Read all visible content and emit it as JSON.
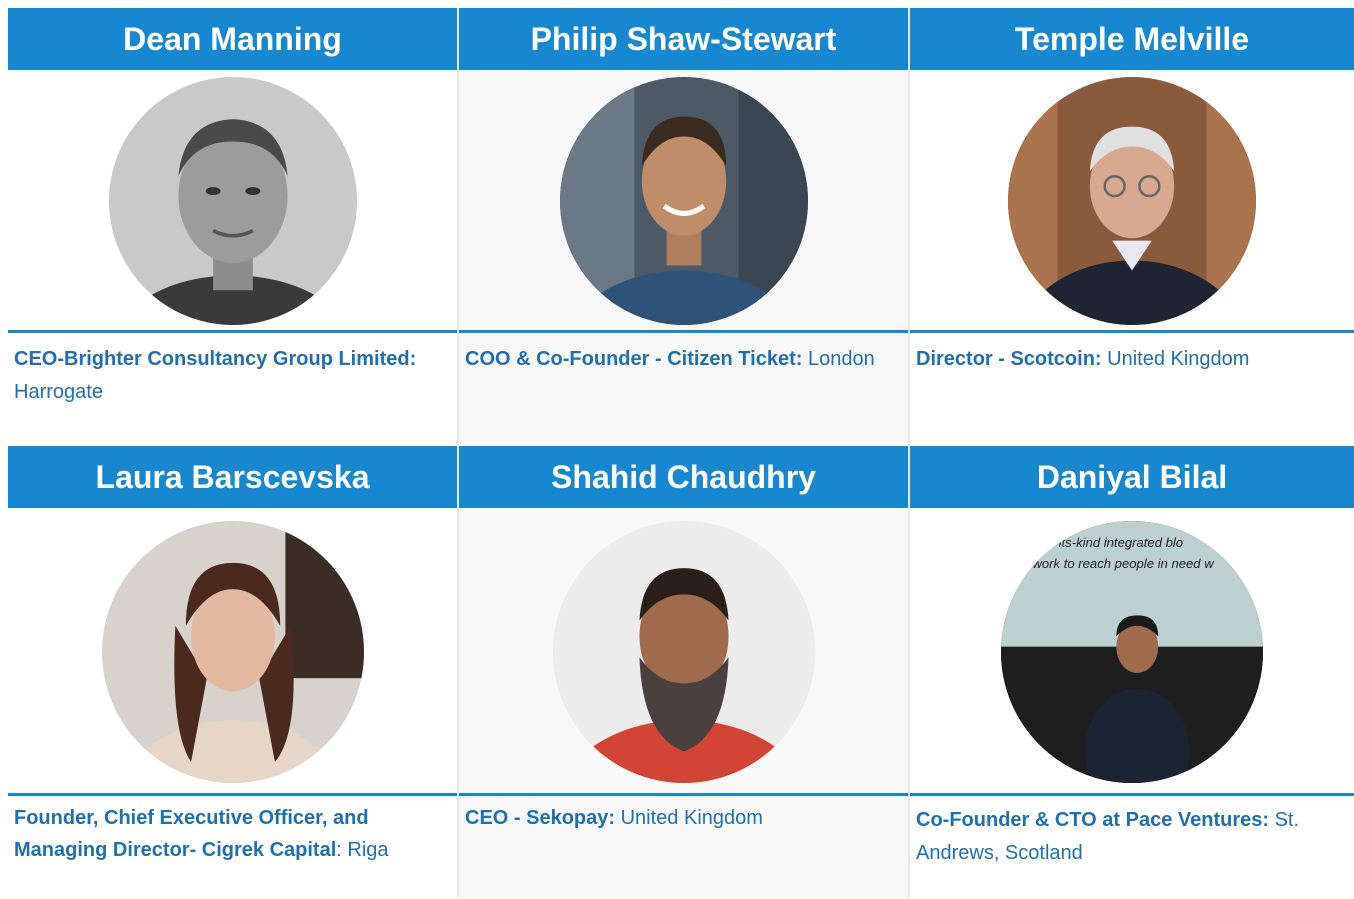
{
  "row1": [
    {
      "name": "Dean Manning",
      "role": "CEO-Brighter Consultancy Group Limited:",
      "location": " Harrogate",
      "photo": "dean-manning-photo"
    },
    {
      "name": "Philip Shaw-Stewart",
      "role": "COO & Co-Founder - Citizen Ticket:",
      "location": " London",
      "photo": "philip-shaw-stewart-photo"
    },
    {
      "name": "Temple Melville",
      "role": "Director - Scotcoin:",
      "location": " United Kingdom",
      "photo": "temple-melville-photo"
    }
  ],
  "row2": [
    {
      "name": "Laura Barscevska",
      "role": "Founder, Chief Executive Officer, and Managing Director- Cigrek Capital",
      "location": ": Riga",
      "photo": "laura-barscevska-photo"
    },
    {
      "name": "Shahid Chaudhry",
      "role": "CEO - Sekopay:",
      "location": " United Kingdom",
      "photo": "shahid-chaudhry-photo"
    },
    {
      "name": "Daniyal Bilal",
      "role": "Co-Founder & CTO at Pace Ventures:",
      "location": " St. Andrews, Scotland",
      "photo": "daniyal-bilal-photo"
    }
  ],
  "backdrop_text": {
    "line1": "its-kind integrated blo",
    "line2": "work to reach people in need w"
  },
  "colors": {
    "accent": "#1787cf",
    "text_blue": "#1f6fb2"
  }
}
